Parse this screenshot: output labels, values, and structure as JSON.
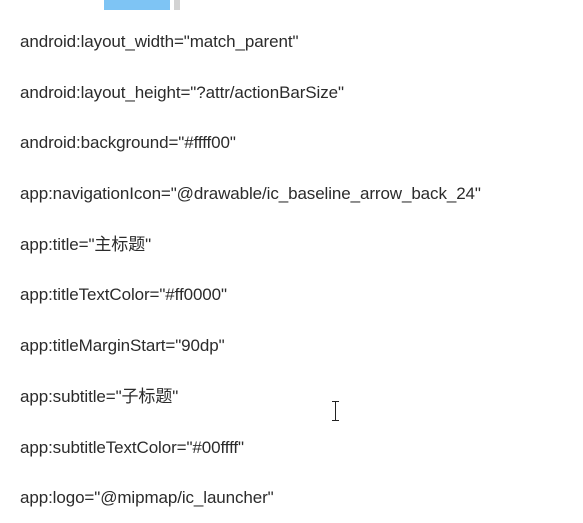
{
  "document": {
    "lines": [
      "android:layout_width=\"match_parent\"",
      "android:layout_height=\"?attr/actionBarSize\"",
      "android:background=\"#ffff00\"",
      "app:navigationIcon=\"@drawable/ic_baseline_arrow_back_24\"",
      "app:title=\"主标题\"",
      "app:titleTextColor=\"#ff0000\"",
      "app:titleMarginStart=\"90dp\"",
      "app:subtitle=\"子标题\"",
      "app:subtitleTextColor=\"#00ffff\"",
      "app:logo=\"@mipmap/ic_launcher\""
    ]
  },
  "colors": {
    "text": "#2b2b2b",
    "fragment_blue": "#7ec4f4",
    "fragment_gray": "#d3d3d3"
  },
  "icons": {
    "cursor": "text-cursor-icon"
  }
}
